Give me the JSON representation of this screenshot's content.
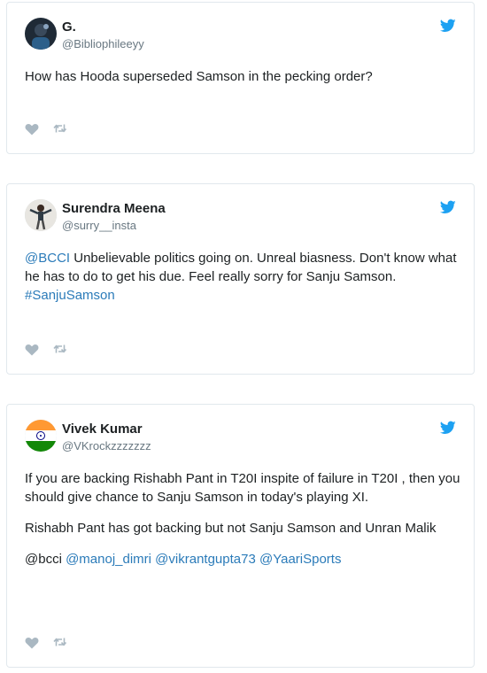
{
  "tweets": [
    {
      "name": "G.",
      "handle": "@Bibliophileeyy",
      "text": "How has Hooda superseded Samson in the pecking order?"
    },
    {
      "name": "Surendra Meena",
      "handle": "@surry__insta",
      "mention": "@BCCI",
      "text": " Unbelievable politics going on. Unreal biasness. Don't know what he has to do to get his due. Feel really sorry for Sanju Samson.",
      "hashtag": "#SanjuSamson"
    },
    {
      "name": "Vivek Kumar",
      "handle": "@VKrockzzzzzzz",
      "para1": "If you are backing Rishabh Pant in T20I inspite of failure in T20I , then you should give chance to Sanju Samson in today's playing XI.",
      "para2": "Rishabh Pant has got backing but not Sanju Samson and Unran Malik",
      "plain_mention": "@bcci",
      "mentions": [
        "@manoj_dimri",
        "@vikrantgupta73",
        "@YaariSports"
      ]
    }
  ],
  "colors": {
    "link": "#2b7bb9",
    "twitter_blue": "#1da1f2",
    "icon_gray": "#aab8c2"
  },
  "icons": {
    "brand": "twitter-bird-icon",
    "like": "heart-icon",
    "retweet": "retweet-icon"
  }
}
